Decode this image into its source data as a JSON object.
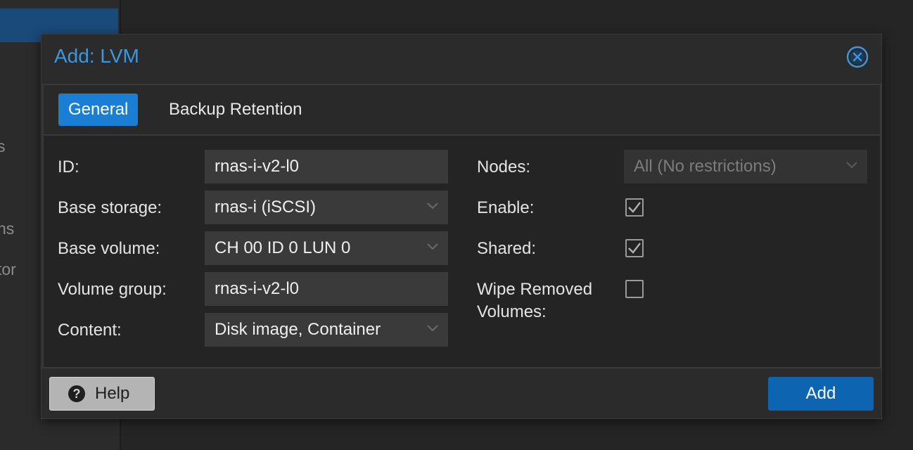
{
  "background": {
    "sidebar_fragments": [
      "s",
      "ns",
      "tor"
    ]
  },
  "dialog": {
    "title": "Add: LVM",
    "close_icon": "close-circle-icon",
    "tabs": [
      {
        "label": "General",
        "active": true
      },
      {
        "label": "Backup Retention",
        "active": false
      }
    ],
    "left_fields": [
      {
        "label": "ID:",
        "value": "rnas-i-v2-l0",
        "type": "text"
      },
      {
        "label": "Base storage:",
        "value": "rnas-i (iSCSI)",
        "type": "select"
      },
      {
        "label": "Base volume:",
        "value": "CH 00 ID 0 LUN 0",
        "type": "select"
      },
      {
        "label": "Volume group:",
        "value": "rnas-i-v2-l0",
        "type": "text"
      },
      {
        "label": "Content:",
        "value": "Disk image, Container",
        "type": "select"
      }
    ],
    "right_fields": {
      "nodes": {
        "label": "Nodes:",
        "value": "All (No restrictions)",
        "disabled": true
      },
      "enable": {
        "label": "Enable:",
        "checked": true
      },
      "shared": {
        "label": "Shared:",
        "checked": true
      },
      "wipe": {
        "label_line1": "Wipe Removed",
        "label_line2": "Volumes:",
        "checked": false
      }
    },
    "footer": {
      "help_label": "Help",
      "help_icon": "question-circle-icon",
      "add_label": "Add"
    }
  },
  "colors": {
    "accent": "#1a7fd4",
    "title": "#3b98e0",
    "add_button": "#0d64b0"
  }
}
